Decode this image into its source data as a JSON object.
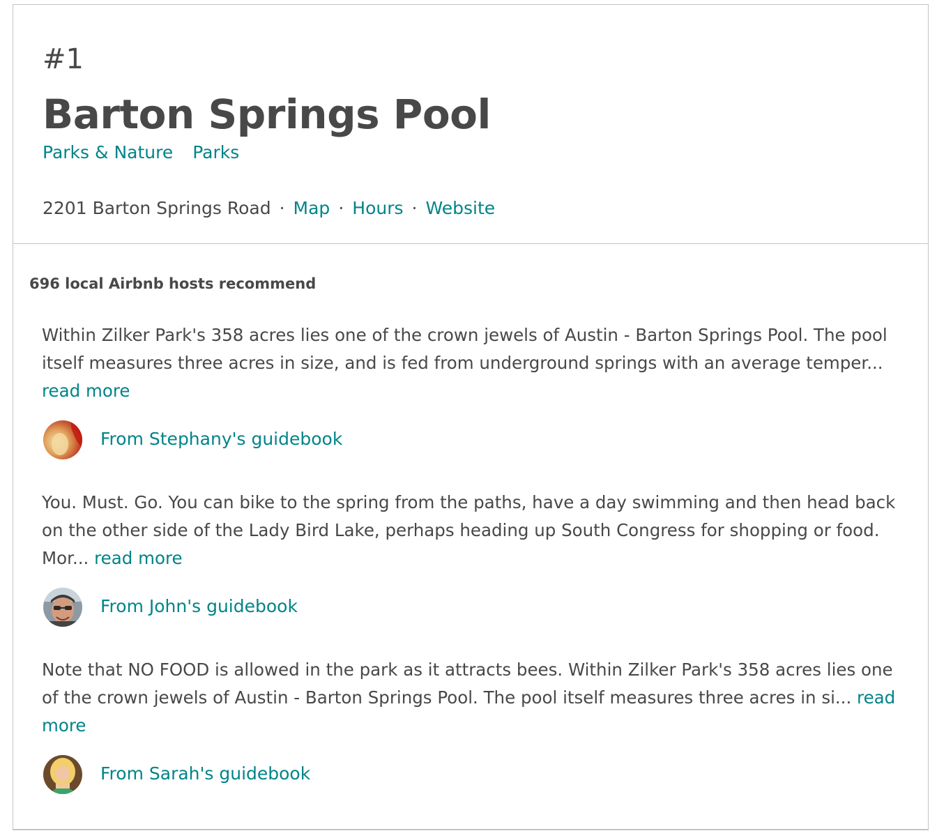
{
  "place": {
    "rank": "#1",
    "name": "Barton Springs Pool",
    "categories": [
      "Parks & Nature",
      "Parks"
    ],
    "address": "2201 Barton Springs Road",
    "separator": "·",
    "links": {
      "map": "Map",
      "hours": "Hours",
      "website": "Website"
    }
  },
  "recommendations": {
    "count_text": "696 local Airbnb hosts recommend",
    "read_more_label": "read more",
    "items": [
      {
        "text": "Within Zilker Park's 358 acres lies one of the crown jewels of Austin - Barton Springs Pool. The pool itself measures three acres in size, and is fed from underground springs with an average temper...",
        "author_link": "From Stephany's guidebook",
        "avatar_icon": "avatar-stephany"
      },
      {
        "text": "You. Must. Go. You can bike to the spring from the paths, have a day swimming and then head back on the other side of the Lady Bird Lake, perhaps heading up South Congress for shopping or food. Mor...",
        "author_link": "From John's guidebook",
        "avatar_icon": "avatar-john"
      },
      {
        "text": "Note that NO FOOD is allowed in the park as it attracts bees. Within Zilker Park's 358 acres lies one of the crown jewels of Austin - Barton Springs Pool. The pool itself measures three acres in si...",
        "author_link": "From Sarah's guidebook",
        "avatar_icon": "avatar-sarah"
      }
    ]
  },
  "colors": {
    "accent": "#008489",
    "text": "#484848",
    "border": "#c4c4c4"
  }
}
